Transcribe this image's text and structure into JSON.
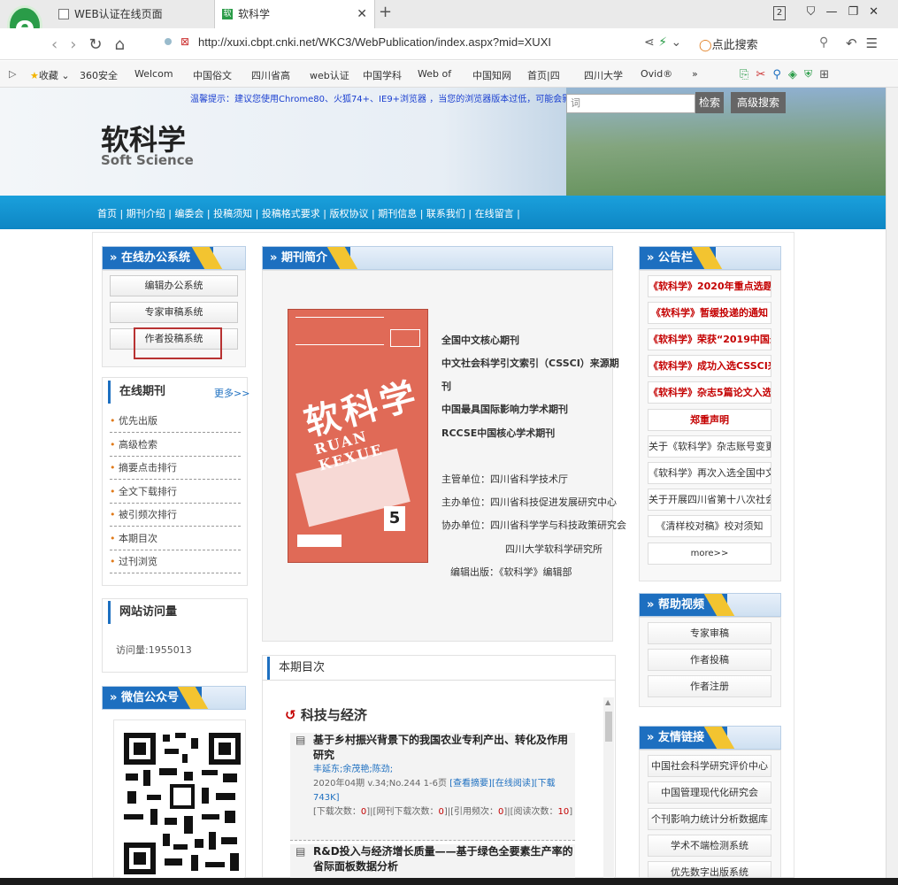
{
  "browser": {
    "tabs": [
      {
        "label": "WEB认证在线页面"
      },
      {
        "label": "软科学"
      }
    ],
    "url": "http://xuxi.cbpt.cnki.net/WKC3/WebPublication/index.aspx?mid=XUXI",
    "search_placeholder": "点此搜索",
    "tab_count": "2",
    "bookmarks": [
      "收藏",
      "360安全",
      "Welcom",
      "中国俗文",
      "四川省高",
      "web认证",
      "中国学科",
      "Web of",
      "中国知网",
      "首页|四",
      "四川大学",
      "Ovid®"
    ]
  },
  "banner": {
    "notice": "温馨提示：建议您使用Chrome80、火狐74+、IE9+浏览器 ，当您的浏览器版本过低，可能会影响部分功能正常使用。",
    "keyword_placeholder": "词",
    "search_btn": "检索",
    "adv_search_btn": "高级搜索",
    "title": "软科学",
    "subtitle": "Soft Science"
  },
  "nav": [
    "首页",
    "期刊介绍",
    "编委会",
    "投稿须知",
    "投稿格式要求",
    "版权协议",
    "期刊信息",
    "联系我们",
    "在线留言"
  ],
  "office": {
    "title": "在线办公系统",
    "buttons": [
      "编辑办公系统",
      "专家审稿系统",
      "作者投稿系统"
    ]
  },
  "online_journal": {
    "title": "在线期刊",
    "more": "更多>>",
    "items": [
      "优先出版",
      "高级检索",
      "摘要点击排行",
      "全文下载排行",
      "被引频次排行",
      "本期目次",
      "过刊浏览"
    ]
  },
  "visits": {
    "title": "网站访问量",
    "count_text": "访问量:1955013"
  },
  "wechat": {
    "title": "微信公众号"
  },
  "intro": {
    "title": "期刊简介",
    "lines": [
      "全国中文核心期刊",
      "中文社会科学引文索引（CSSCI）来源期",
      "刊",
      "中国最具国际影响力学术期刊",
      "RCCSE中国核心学术期刊"
    ],
    "org_lines": [
      "主管单位：四川省科学技术厅",
      "主办单位：四川省科技促进发展研究中心",
      "协办单位：四川省科学学与科技政策研究会",
      "四川大学软科学研究所",
      "编辑出版：《软科学》编辑部"
    ],
    "cover_title": "软科学",
    "cover_pinyin": "RUAN KEXUE",
    "cover_issue": "5"
  },
  "toc": {
    "title": "本期目次",
    "section": "科技与经济",
    "articles": [
      {
        "title": "基于乡村振兴背景下的我国农业专利产出、转化及作用研究",
        "authors": "丰延东;余茂艳;陈劲;",
        "meta": "2020年04期 v.34;No.244 1-6页",
        "links": "[查看摘要][在线阅读][下载743K]",
        "stats_a": "[下载次数：",
        "stats_a_val": "0",
        "stats_b": "]|[网刊下载次数：",
        "stats_b_val": "0",
        "stats_c": "]|[引用频次：",
        "stats_c_val": "0",
        "stats_d": "]|[阅读次数：",
        "stats_d_val": "10",
        "stats_e": "]"
      },
      {
        "title": "R&D投入与经济增长质量——基于绿色全要素生产率的省际面板数据分析"
      }
    ]
  },
  "bulletin": {
    "title": "公告栏",
    "red_items": [
      "《软科学》2020年重点选题",
      "《软科学》暂缓投递的通知",
      "《软科学》荣获“2019中国最",
      "《软科学》成功入选CSSCI来",
      "《软科学》杂志5篇论文入选",
      "郑重声明"
    ],
    "items": [
      "关于《软科学》杂志账号变更的",
      "《软科学》再次入选全国中文核",
      "关于开展四川省第十八次社会科",
      "《清样校对稿》校对须知"
    ],
    "more": "more>>"
  },
  "help": {
    "title": "帮助视频",
    "buttons": [
      "专家审稿",
      "作者投稿",
      "作者注册"
    ]
  },
  "links": {
    "title": "友情链接",
    "items": [
      "中国社会科学研究评价中心",
      "中国管理现代化研究会",
      "个刊影响力统计分析数据库",
      "学术不端检测系统",
      "优先数字出版系统"
    ]
  }
}
